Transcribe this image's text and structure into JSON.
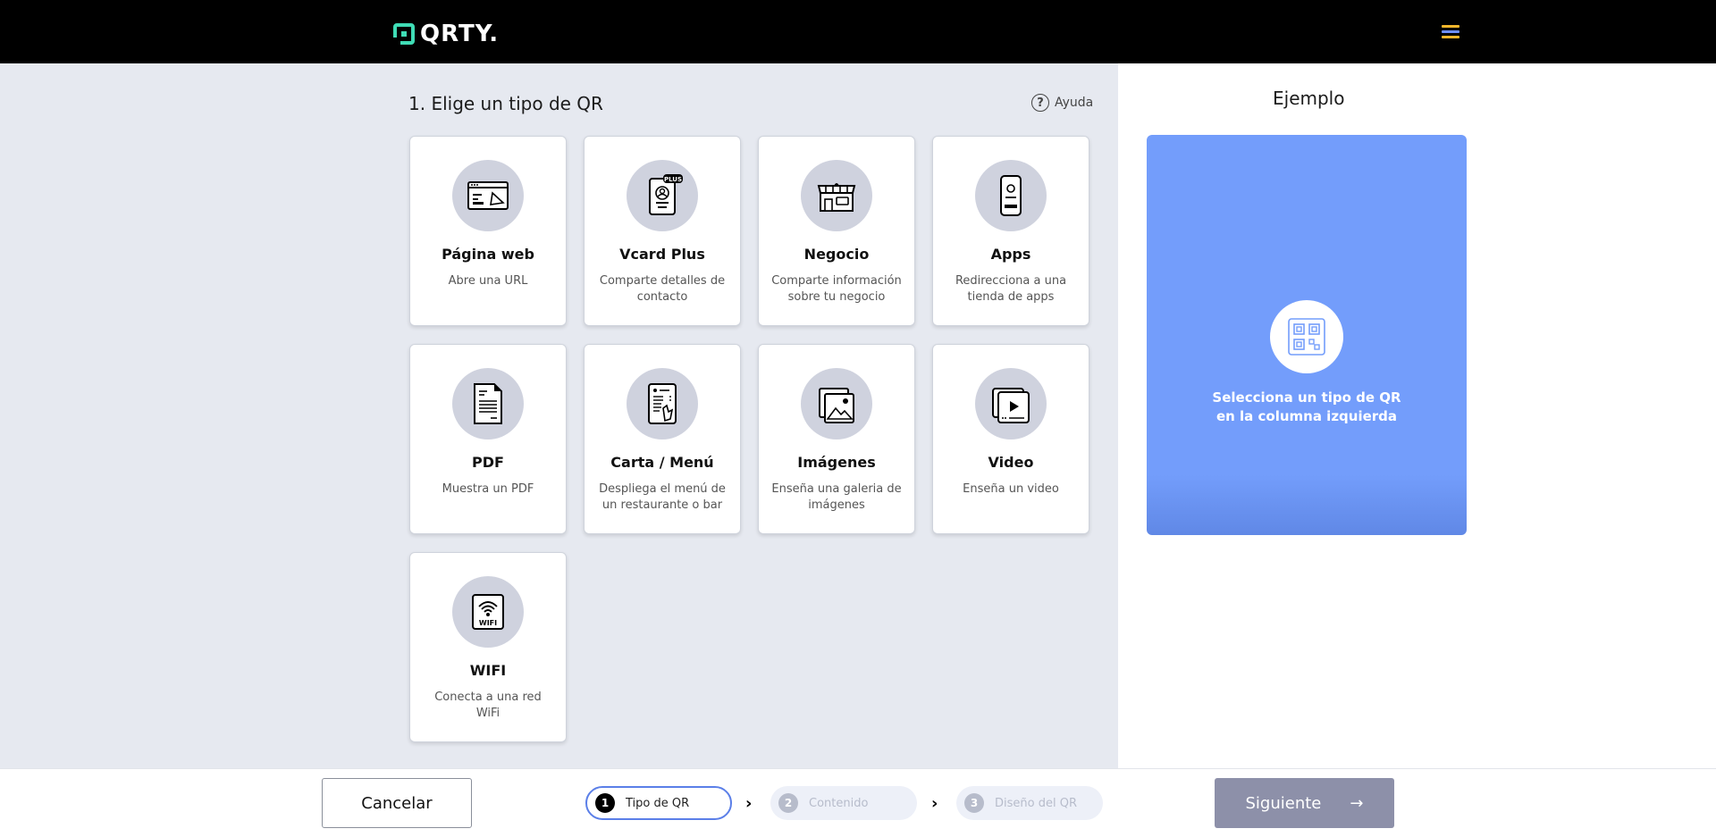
{
  "header": {
    "logo_text": "QRTY.",
    "brand_color": "#3fdcb5",
    "menu_icon": "hamburger-icon"
  },
  "main": {
    "title": "1. Elige un tipo de QR",
    "help_label": "Ayuda",
    "cards": [
      {
        "icon": "webpage-icon",
        "title": "Página web",
        "desc": "Abre una URL"
      },
      {
        "icon": "vcard-plus-icon",
        "title": "Vcard Plus",
        "desc": "Comparte detalles de contacto"
      },
      {
        "icon": "store-icon",
        "title": "Negocio",
        "desc": "Comparte información sobre tu negocio"
      },
      {
        "icon": "smartphone-icon",
        "title": "Apps",
        "desc": "Redirecciona a una tienda de apps"
      },
      {
        "icon": "pdf-document-icon",
        "title": "PDF",
        "desc": "Muestra un PDF"
      },
      {
        "icon": "menu-card-icon",
        "title": "Carta / Menú",
        "desc": "Despliega el menú de un restaurante o bar"
      },
      {
        "icon": "images-icon",
        "title": "Imágenes",
        "desc": "Enseña una galeria de imágenes"
      },
      {
        "icon": "video-icon",
        "title": "Video",
        "desc": "Enseña un video"
      },
      {
        "icon": "wifi-icon",
        "title": "WIFI",
        "desc": "Conecta a una red WiFi"
      }
    ]
  },
  "preview": {
    "title": "Ejemplo",
    "text_line1": "Selecciona un tipo de QR",
    "text_line2": "en la columna izquierda",
    "icon": "qr-code-icon",
    "box_color": "#739dfb"
  },
  "footer": {
    "cancel_label": "Cancelar",
    "next_label": "Siguiente",
    "steps": [
      {
        "num": "1",
        "label": "Tipo de QR",
        "state": "active"
      },
      {
        "num": "2",
        "label": "Contenido",
        "state": "inactive"
      },
      {
        "num": "3",
        "label": "Diseño del QR",
        "state": "inactive"
      }
    ]
  }
}
